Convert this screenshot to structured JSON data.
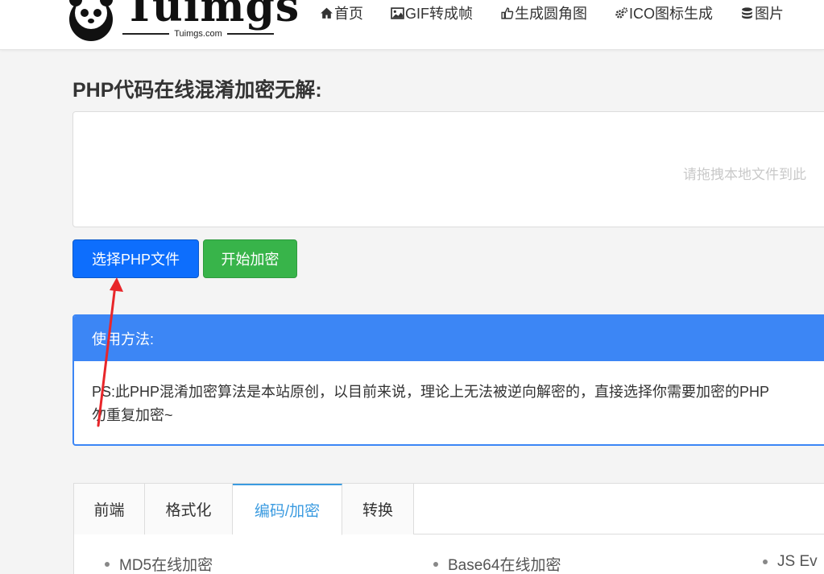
{
  "header": {
    "logo_text": "Tuimgs",
    "logo_sub": "Tuimgs.com",
    "nav": [
      {
        "label": "首页",
        "icon": "home-icon"
      },
      {
        "label": "GIF转成帧",
        "icon": "image-icon"
      },
      {
        "label": "生成圆角图",
        "icon": "thumbs-up-icon"
      },
      {
        "label": "ICO图标生成",
        "icon": "gears-icon"
      },
      {
        "label": "图片",
        "icon": "database-icon"
      }
    ]
  },
  "main": {
    "title": "PHP代码在线混淆加密无解:",
    "drop_hint": "请拖拽本地文件到此",
    "select_button": "选择PHP文件",
    "start_button": "开始加密"
  },
  "panel": {
    "heading": "使用方法:",
    "line1": "PS:此PHP混淆加密算法是本站原创，以目前来说，理论上无法被逆向解密的，直接选择你需要加密的PHP",
    "line2": "勿重复加密~"
  },
  "tabs": {
    "items": [
      "前端",
      "格式化",
      "编码/加密",
      "转换"
    ],
    "active_index": 2,
    "links": [
      "MD5在线加密",
      "Base64在线加密",
      "JS Ev"
    ]
  },
  "colors": {
    "primary": "#0d6efd",
    "success": "#38b44a",
    "panel": "#3c86f5",
    "tab_active": "#3b9be0",
    "arrow": "#e8262a"
  }
}
